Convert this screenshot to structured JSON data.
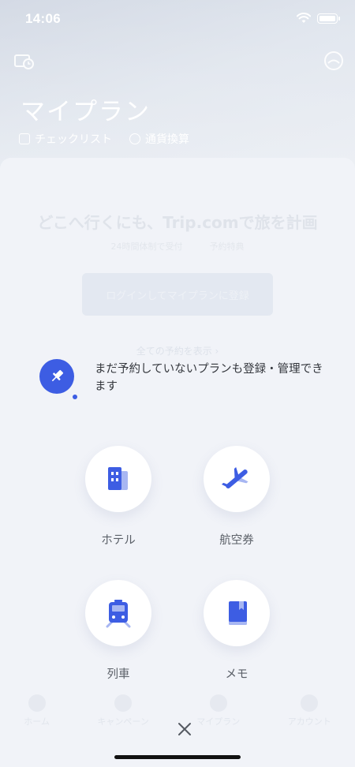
{
  "status_bar": {
    "time": "14:06"
  },
  "background_page": {
    "title": "マイプラン",
    "links": [
      {
        "label": "チェックリスト",
        "icon": "checklist-icon"
      },
      {
        "label": "通貨換算",
        "icon": "currency-icon"
      }
    ],
    "headline": "どこへ行くにも、Trip.comで旅を計画",
    "features": [
      {
        "label": "24時間体制で受付",
        "icon": "support-icon"
      },
      {
        "label": "予約特典",
        "icon": "perk-icon"
      }
    ],
    "cta_label": "ログインしてマイプランに登録",
    "all_reservations_link": "全ての予約を表示 ›",
    "tabs": [
      "ホーム",
      "キャンペーン",
      "マイプラン",
      "アカウント"
    ]
  },
  "overlay": {
    "message": "まだ予約していないプランも登録・管理できます",
    "options": [
      {
        "label": "ホテル",
        "icon": "hotel-icon"
      },
      {
        "label": "航空券",
        "icon": "airplane-icon"
      },
      {
        "label": "列車",
        "icon": "train-icon"
      },
      {
        "label": "メモ",
        "icon": "notebook-icon"
      }
    ]
  },
  "colors": {
    "accent": "#3D5DE3",
    "accent_light": "#A7B6F2"
  }
}
